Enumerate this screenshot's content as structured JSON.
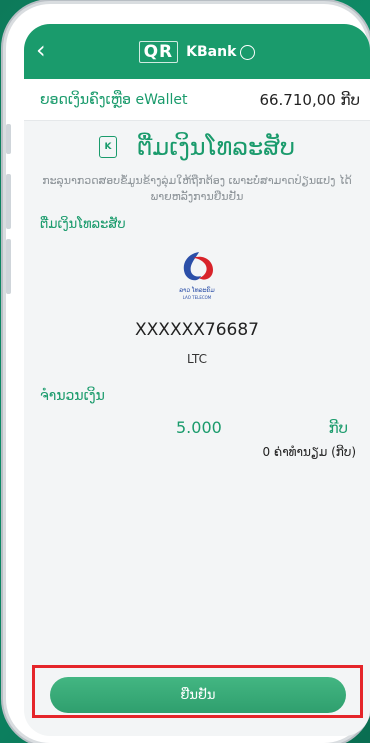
{
  "header": {
    "logo_qr": "QR",
    "logo_brand": "KBank"
  },
  "wallet": {
    "label": "ຍອດເງິນຄົງເຫຼືອ eWallet",
    "amount": "66.710,00 ກີບ"
  },
  "page_title": "ຕື່ມເງິນໂທລະສັບ",
  "note": "ກະລຸນາກວດສອບຂໍ້ມູນຂ້າງລຸ່ມໃຫ້ຖືກຕ້ອງ ເພາະບໍ່ສາມາດປ່ຽນແປງ ໄດ້ພາຍຫລັງການຢືນຢັນ",
  "topup": {
    "section_label": "ຕື່ມເງິນໂທລະສັບ",
    "operator_logo_text_lao": "ລາວ ໂທລະຄົມ",
    "operator_logo_text_en": "LAO TELECOM",
    "phone_number": "XXXXXX76687",
    "operator_code": "LTC"
  },
  "amount": {
    "label": "ຈຳນວນເງິນ",
    "value": "5.000",
    "currency": "ກີບ",
    "fee": "0  ຄ່າທຳນຽມ (ກີບ)"
  },
  "confirm": {
    "label": "ຢືນຢັນ"
  },
  "colors": {
    "brand": "#1a9b6c",
    "highlight": "#e5252a"
  }
}
